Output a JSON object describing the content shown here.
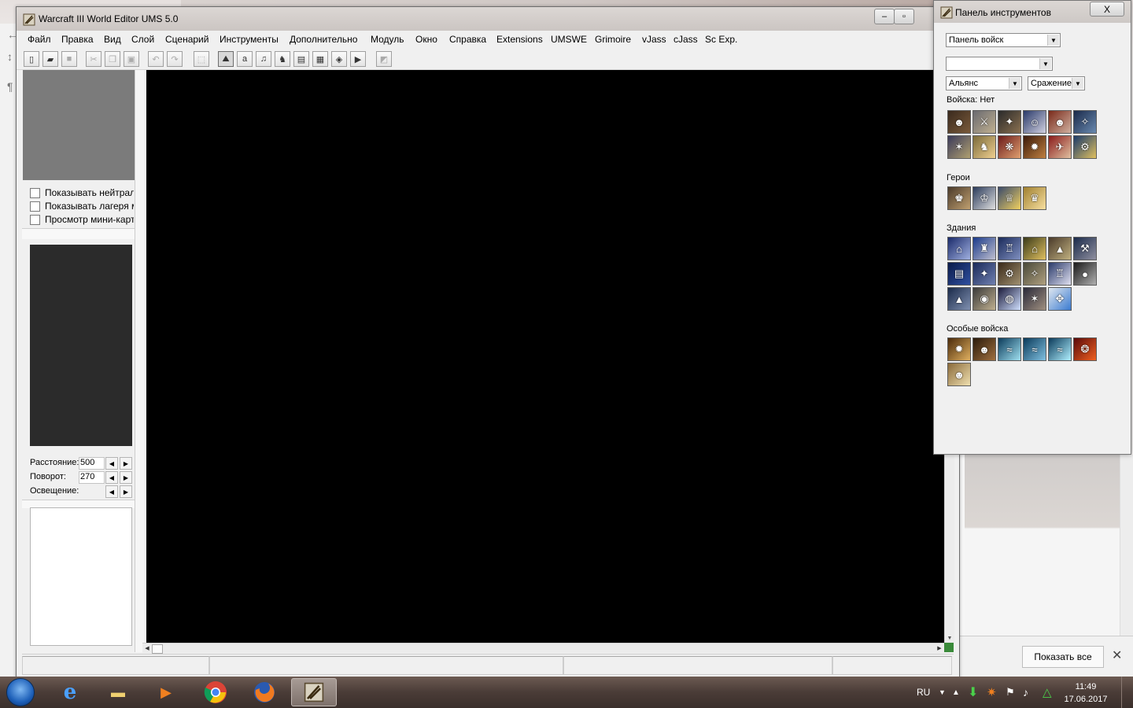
{
  "window": {
    "title": "Warcraft III World Editor UMS 5.0",
    "controls": [
      "‒",
      "▫",
      "✕"
    ]
  },
  "menu": [
    "Файл",
    "Правка",
    "Вид",
    "Слой",
    "Сценарий",
    "Инструменты",
    "Дополнительно",
    "Модуль",
    "Окно",
    "Справка",
    "Extensions",
    "UMSWE",
    "Grimoire",
    "vJass",
    "cJass",
    "Sc Exp."
  ],
  "left_panel": {
    "checkboxes": [
      "Показывать нейтраль",
      "Показывать лагеря м",
      "Просмотр мини-карты"
    ],
    "camera": {
      "distance_label": "Расстояние:",
      "distance_value": "500",
      "rotation_label": "Поворот:",
      "rotation_value": "270",
      "lighting_label": "Освещение:"
    }
  },
  "palette": {
    "title": "Панель инструментов",
    "close": "X",
    "main_combo": "Панель войск",
    "player_combo": "",
    "race_combo": "Альянс",
    "mode_combo": "Сражение",
    "sections": {
      "units": "Войска: Нет",
      "heroes": "Герои",
      "buildings": "Здания",
      "special": "Особые войска"
    }
  },
  "browser": {
    "show_all_button": "Показать все"
  },
  "taskbar": {
    "language": "RU",
    "time": "11:49",
    "date": "17.06.2017"
  },
  "colors": {
    "viewport": "#000000",
    "minimap": "#7b7b7b",
    "preview": "#2b2b2b"
  }
}
